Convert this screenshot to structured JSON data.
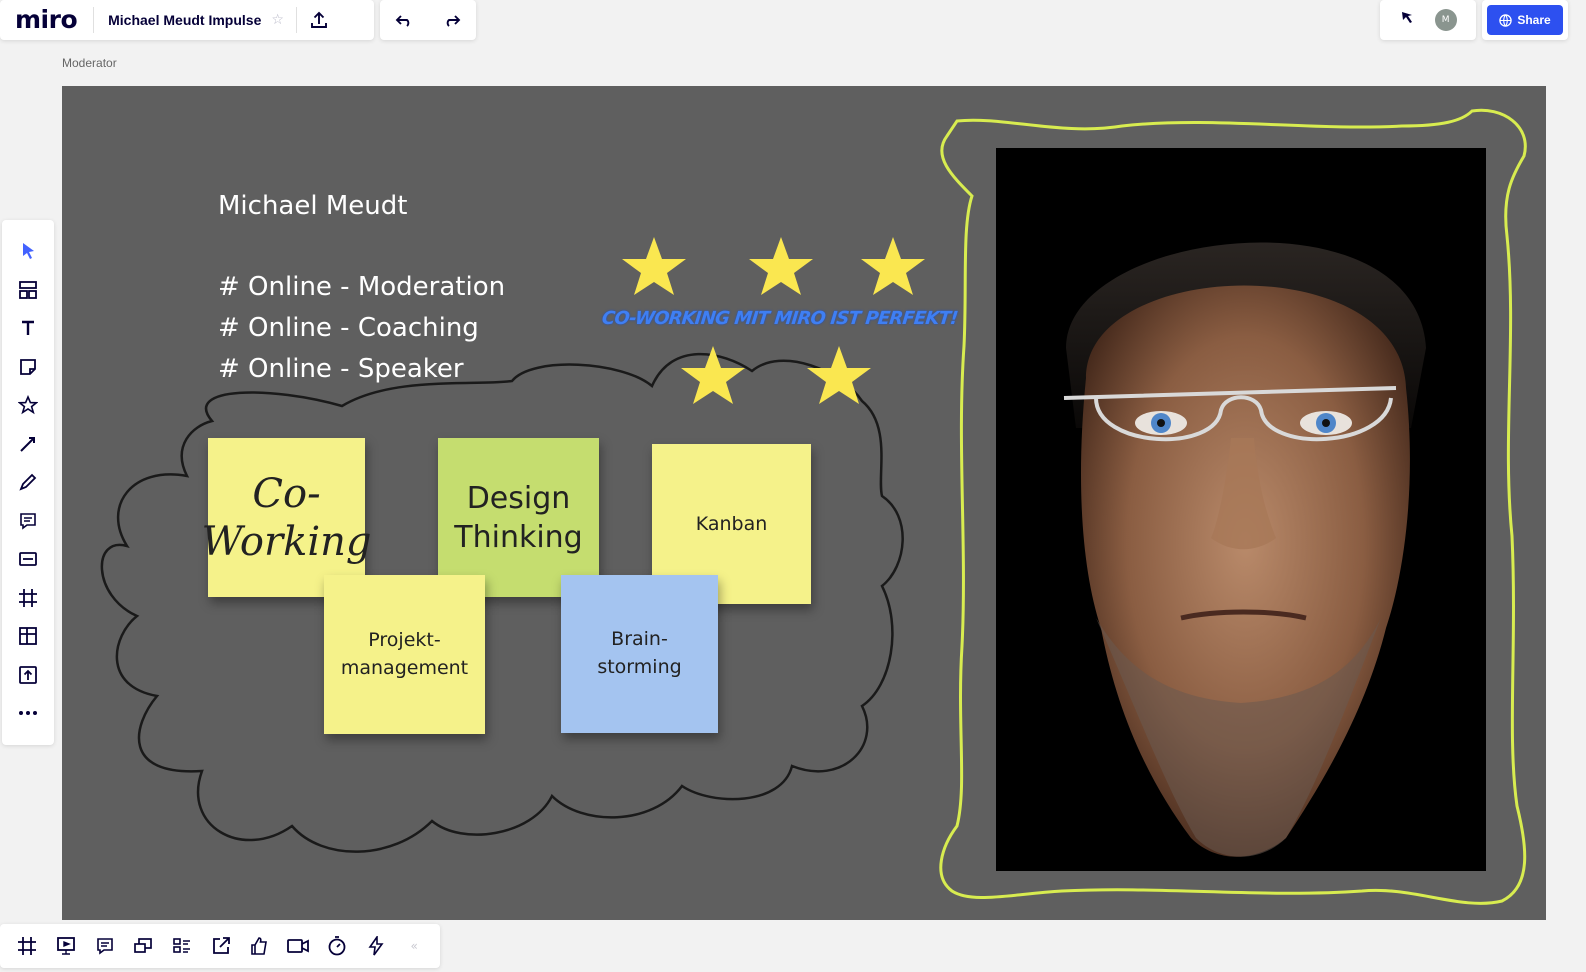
{
  "app": {
    "logo": "miro",
    "board_title": "Michael Meudt Impulse"
  },
  "topbar": {
    "star_icon": "star-outline-icon",
    "upload_icon": "upload-icon",
    "undo_icon": "undo-icon",
    "redo_icon": "redo-icon",
    "cursor_icon": "cursor-icon",
    "avatar_initial": "M",
    "share_label": "Share"
  },
  "frame": {
    "label": "Moderator"
  },
  "board": {
    "name": "Michael Meudt",
    "lines": [
      "# Online - Moderation",
      "# Online - Coaching",
      "# Online - Speaker"
    ],
    "banner": "CO-WORKING MIT MIRO IST PERFEKT!",
    "stickies": [
      {
        "text": "Co-\nWorking",
        "color": "#f5f28a"
      },
      {
        "text": "Design\nThinking",
        "color": "#c5dd6f"
      },
      {
        "text": "Kanban",
        "color": "#f5f28a"
      },
      {
        "text": "Projekt-\nmanagement",
        "color": "#f5f28a"
      },
      {
        "text": "Brain-\nstorming",
        "color": "#a4c4f0"
      }
    ],
    "star_color": "#fae750",
    "photo_frame_color": "#d8ec50"
  },
  "left_toolbar": [
    "select-icon",
    "templates-icon",
    "text-icon",
    "sticky-note-icon",
    "shapes-icon",
    "connection-line-icon",
    "pen-icon",
    "comment-icon",
    "card-icon",
    "frame-icon",
    "kanban-icon",
    "upload-icon",
    "more-icon"
  ],
  "bottom_toolbar": [
    "frames-icon",
    "presentation-icon",
    "comments-icon",
    "screen-share-icon",
    "card-list-icon",
    "embed-icon",
    "voting-icon",
    "video-chat-icon",
    "timer-icon",
    "activity-icon",
    "collapse-icon"
  ]
}
